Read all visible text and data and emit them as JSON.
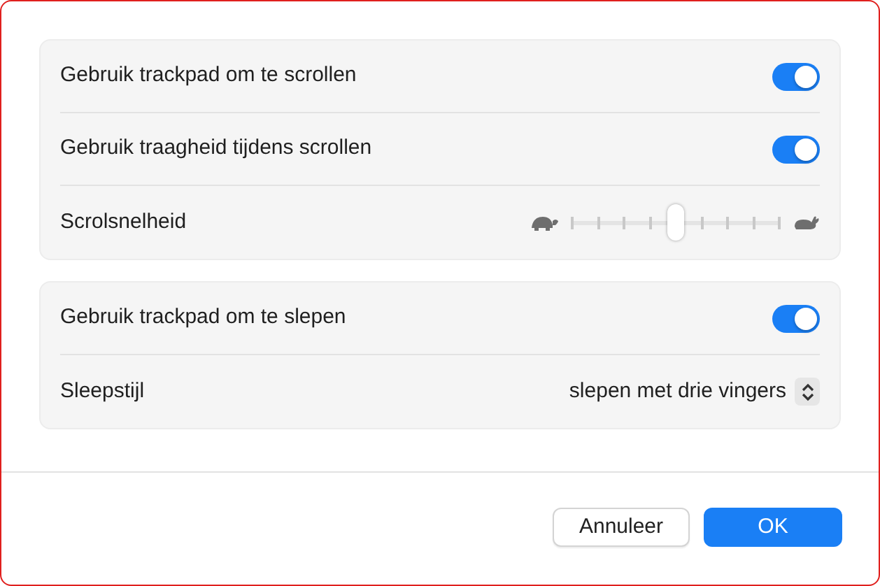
{
  "groups": [
    {
      "rows": [
        {
          "kind": "toggle",
          "label": "Gebruik trackpad om te scrollen",
          "on": true
        },
        {
          "kind": "toggle",
          "label": "Gebruik traagheid tijdens scrollen",
          "on": true
        },
        {
          "kind": "slider",
          "label": "Scrolsnelheid",
          "level": 0.5
        }
      ]
    },
    {
      "rows": [
        {
          "kind": "toggle",
          "label": "Gebruik trackpad om te slepen",
          "on": true
        },
        {
          "kind": "popup",
          "label": "Sleepstijl",
          "value": "slepen met drie vingers"
        }
      ]
    }
  ],
  "buttons": [
    {
      "label": "Annuleer",
      "kind": "secondary"
    },
    {
      "label": "OK",
      "kind": "primary"
    }
  ]
}
